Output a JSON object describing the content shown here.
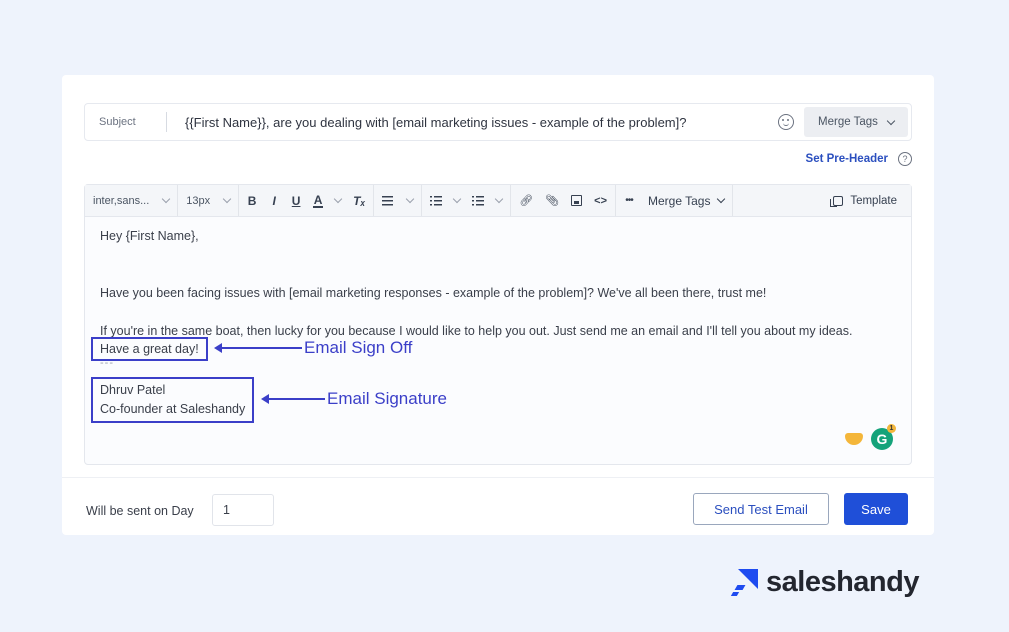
{
  "subject": {
    "label": "Subject",
    "value": "{{First Name}}, are you dealing with [email marketing issues - example of the problem]?",
    "merge_tags_label": "Merge Tags"
  },
  "preheader": {
    "link_label": "Set Pre-Header",
    "help_glyph": "?"
  },
  "toolbar": {
    "font_family": "inter,sans...",
    "font_size": "13px",
    "bold": "B",
    "italic": "I",
    "underline": "U",
    "text_color": "A",
    "clear_format": "Tₓ",
    "code": "<>",
    "more": "•••",
    "merge_tags_label": "Merge Tags",
    "template_label": "Template",
    "link_glyph": "🔗",
    "attach_glyph": "📎"
  },
  "body": {
    "greeting": "Hey {First Name},",
    "paragraph1": "Have you been facing issues with [email marketing responses - example of the problem]? We've all been there, trust me!",
    "paragraph2": "If you're in the same boat, then lucky for you because I would like to help you out. Just send me an email and I'll tell you about my ideas.",
    "sign_off": "Have a great day!",
    "separator": "---",
    "signature_name": "Dhruv Patel",
    "signature_title": "Co-founder at Saleshandy"
  },
  "annotations": {
    "sign_off": "Email Sign Off",
    "signature": "Email Signature",
    "color": "#3b3fc8"
  },
  "extensions": {
    "grammarly_letter": "G",
    "grammarly_count": "1"
  },
  "footer": {
    "day_label": "Will be sent on Day",
    "day_value": "1",
    "send_test_label": "Send Test Email",
    "save_label": "Save"
  },
  "brand": {
    "name": "saleshandy",
    "accent": "#1e4bf0"
  }
}
